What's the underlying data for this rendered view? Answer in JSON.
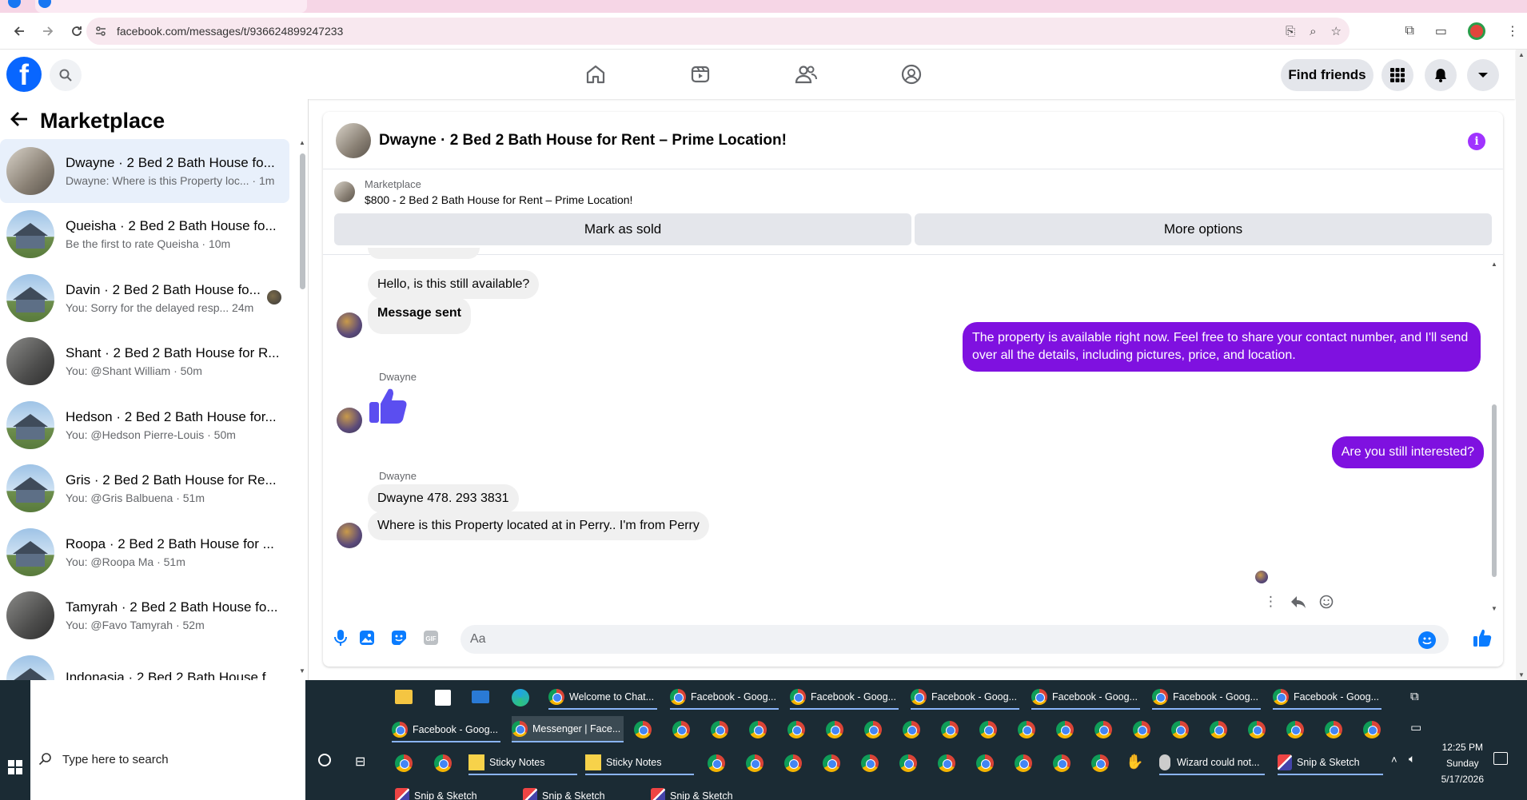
{
  "browser": {
    "url": "facebook.com/messages/t/936624899247233"
  },
  "fb_header": {
    "find_friends_label": "Find friends"
  },
  "left_panel": {
    "title": "Marketplace",
    "conversations": [
      {
        "title": "Dwayne · 2 Bed 2 Bath House fo...",
        "preview": "Dwayne: Where is this Property loc... · 1m",
        "active": true,
        "thumb": "interior"
      },
      {
        "title": "Queisha · 2 Bed 2 Bath House fo...",
        "preview": "Be the first to rate Queisha · 10m",
        "thumb": "house"
      },
      {
        "title": "Davin · 2 Bed 2 Bath House fo...",
        "preview": "You: Sorry for the delayed resp...  24m",
        "thumb": "house",
        "seen": true
      },
      {
        "title": "Shant · 2 Bed 2 Bath House for R...",
        "preview": "You: @Shant William · 50m",
        "thumb": "interior-dark"
      },
      {
        "title": "Hedson · 2 Bed 2 Bath House for...",
        "preview": "You: @Hedson Pierre-Louis · 50m",
        "thumb": "house"
      },
      {
        "title": "Gris · 2 Bed 2 Bath House for Re...",
        "preview": "You: @Gris Balbuena · 51m",
        "thumb": "house"
      },
      {
        "title": "Roopa · 2 Bed 2 Bath House for ...",
        "preview": "You: @Roopa Ma · 51m",
        "thumb": "house"
      },
      {
        "title": "Tamyrah · 2 Bed 2 Bath House fo...",
        "preview": "You: @Favo Tamyrah · 52m",
        "thumb": "interior-dark"
      },
      {
        "title": "Indonasia · 2 Bed 2 Bath House f...",
        "preview": "",
        "thumb": "house"
      }
    ]
  },
  "chat": {
    "title": "Dwayne · 2 Bed 2 Bath House for Rent – Prime Location!",
    "listing_source": "Marketplace",
    "listing_title": "$800 - 2 Bed 2 Bath House for Rent – Prime Location!",
    "mark_sold_label": "Mark as sold",
    "more_options_label": "More options",
    "messages": {
      "m1": "Hello, is this still available?",
      "m2": "Message sent",
      "m3": "The property is available right now. Feel free to share your contact number, and I'll send over all the details, including pictures, price, and location.",
      "sender1": "Dwayne",
      "m5": "Are you still interested?",
      "sender2": "Dwayne",
      "m6": "Dwayne 478. 293 3831",
      "m7": "Where is this Property located at in Perry.. I'm from Perry"
    },
    "composer_placeholder": "Aa"
  },
  "taskbar": {
    "search_placeholder": "Type here to search",
    "row1": [
      "Welcome to Chat...",
      "Facebook - Goog...",
      "Facebook - Goog...",
      "Facebook - Goog...",
      "Facebook - Goog...",
      "Facebook - Goog...",
      "Facebook - Goog..."
    ],
    "row2": [
      "Facebook - Goog...",
      "Messenger | Face..."
    ],
    "row3": [
      "Sticky Notes",
      "Sticky Notes",
      "Wizard could not...",
      "Snip & Sketch"
    ],
    "row4": [
      "Snip & Sketch",
      "Snip & Sketch",
      "Snip & Sketch"
    ],
    "clock_time": "12:25 PM",
    "clock_day": "Sunday",
    "clock_date": "5/17/2026"
  }
}
